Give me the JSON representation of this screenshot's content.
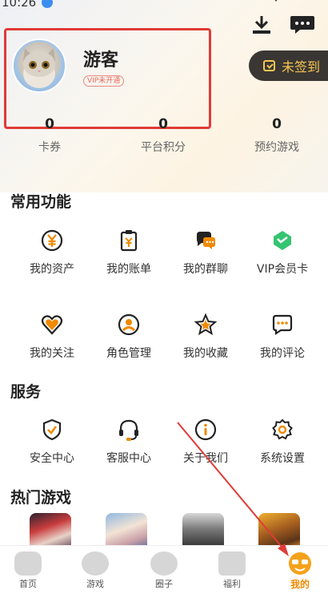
{
  "status_bar": {
    "time": "10:26"
  },
  "profile": {
    "username": "游客",
    "vip_badge": "VIP未开通",
    "checkin_label": "未签到"
  },
  "stats": [
    {
      "value": "0",
      "label": "卡券"
    },
    {
      "value": "0",
      "label": "平台积分"
    },
    {
      "value": "0",
      "label": "预约游戏"
    }
  ],
  "common_functions": {
    "title": "常用功能",
    "items": [
      {
        "label": "我的资产",
        "icon": "yen-coin-icon"
      },
      {
        "label": "我的账单",
        "icon": "bill-icon"
      },
      {
        "label": "我的群聊",
        "icon": "group-chat-icon"
      },
      {
        "label": "VIP会员卡",
        "icon": "vip-diamond-icon"
      },
      {
        "label": "我的关注",
        "icon": "heart-icon"
      },
      {
        "label": "角色管理",
        "icon": "person-icon"
      },
      {
        "label": "我的收藏",
        "icon": "star-icon"
      },
      {
        "label": "我的评论",
        "icon": "comment-icon"
      }
    ]
  },
  "services": {
    "title": "服务",
    "items": [
      {
        "label": "安全中心",
        "icon": "shield-icon"
      },
      {
        "label": "客服中心",
        "icon": "headset-icon"
      },
      {
        "label": "关于我们",
        "icon": "info-icon"
      },
      {
        "label": "系统设置",
        "icon": "gear-icon"
      }
    ]
  },
  "hot_games": {
    "title": "热门游戏"
  },
  "tabbar": {
    "items": [
      {
        "label": "首页",
        "icon": "home-icon"
      },
      {
        "label": "游戏",
        "icon": "game-heart-icon"
      },
      {
        "label": "圈子",
        "icon": "circle-icon"
      },
      {
        "label": "福利",
        "icon": "gift-icon"
      },
      {
        "label": "我的",
        "icon": "mine-face-icon"
      }
    ]
  },
  "colors": {
    "accent": "#f08a00",
    "checkin_bg": "#3a3633",
    "checkin_text": "#f6c64f",
    "highlight": "#e03b36"
  }
}
